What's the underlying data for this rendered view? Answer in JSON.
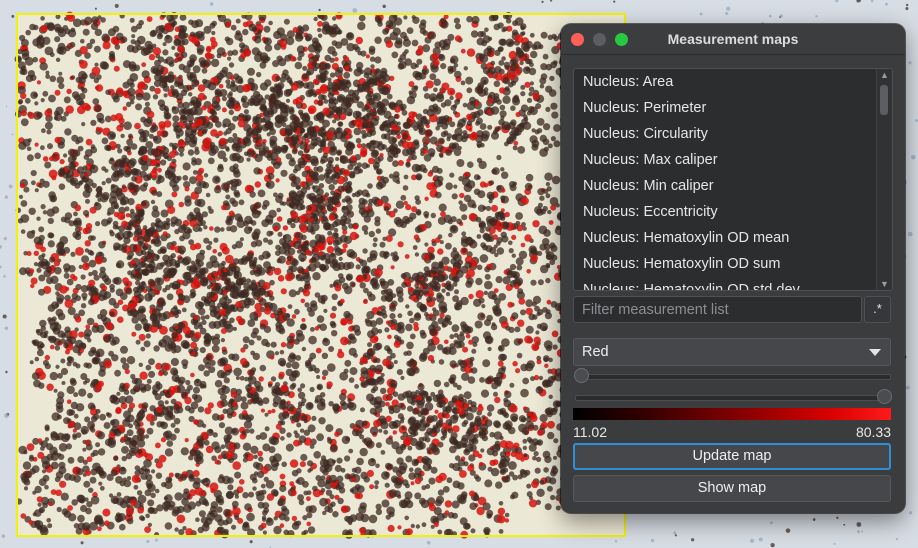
{
  "dialog": {
    "title": "Measurement maps",
    "measurements": [
      "Nucleus: Area",
      "Nucleus: Perimeter",
      "Nucleus: Circularity",
      "Nucleus: Max caliper",
      "Nucleus: Min caliper",
      "Nucleus: Eccentricity",
      "Nucleus: Hematoxylin OD mean",
      "Nucleus: Hematoxylin OD sum",
      "Nucleus: Hematoxylin OD std dev"
    ],
    "filter_placeholder": "Filter measurement list",
    "regex_label": ".*",
    "colormap": "Red",
    "min_slider_position": 0.0,
    "max_slider_position": 1.0,
    "colormap_start_color": "#000000",
    "colormap_end_color": "#ff1a1a",
    "range_min": "11.02",
    "range_max": "80.33",
    "update_button": "Update map",
    "show_button": "Show map"
  },
  "viewer": {
    "annotation_color": "#f1f10c",
    "background_color": "#ece8d6",
    "measurement_map_color": "#d8140f"
  }
}
